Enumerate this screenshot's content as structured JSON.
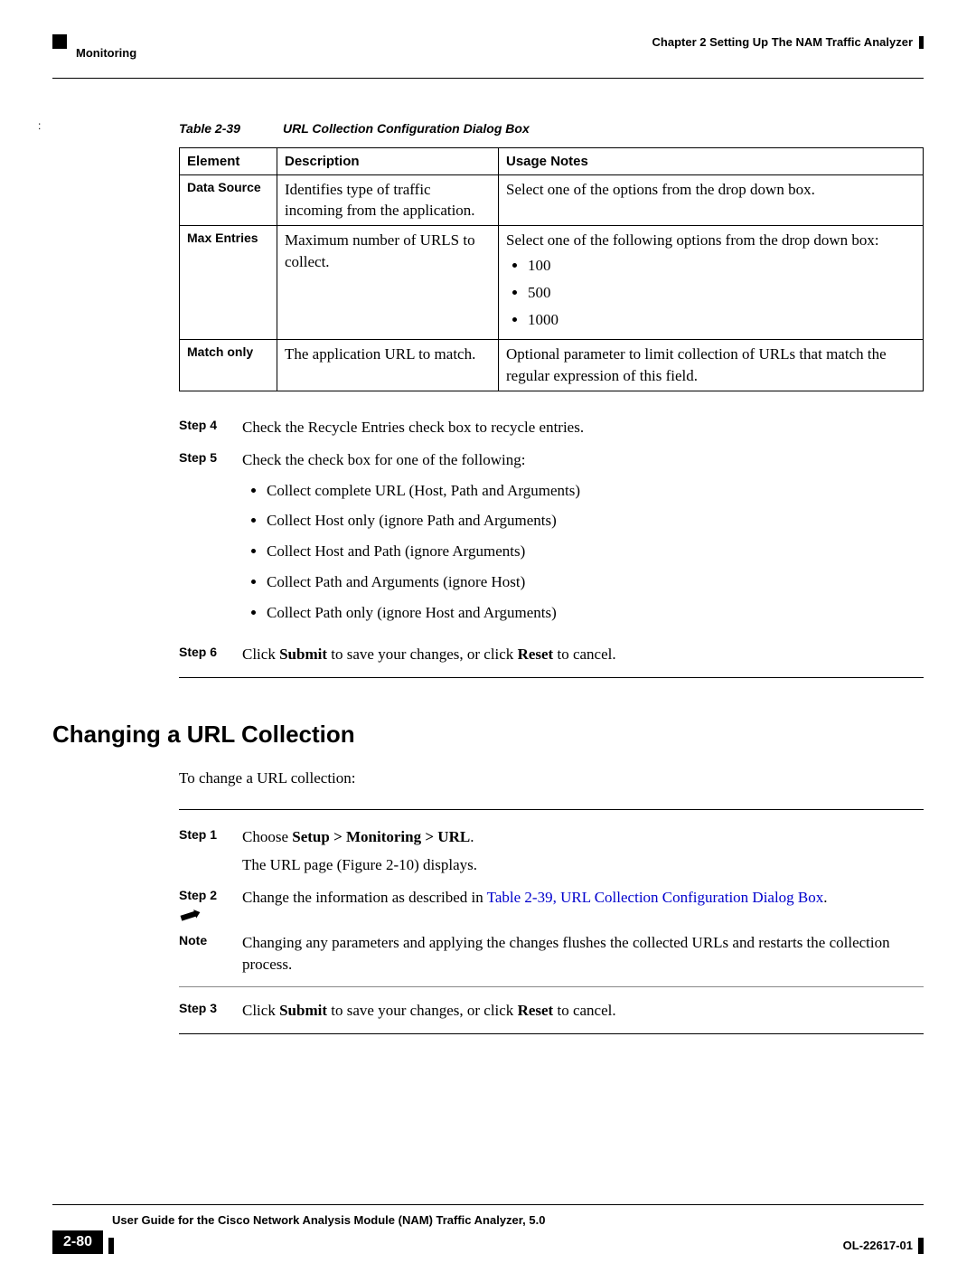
{
  "header": {
    "chapter_right": "Chapter 2      Setting Up The NAM Traffic Analyzer",
    "section_left": "Monitoring"
  },
  "table": {
    "caption_num": "Table 2-39",
    "caption_title": "URL Collection Configuration Dialog Box",
    "headers": {
      "c0": "Element",
      "c1": "Description",
      "c2": "Usage Notes"
    },
    "rows": {
      "r0": {
        "el": "Data Source",
        "desc": "Identifies type of traffic incoming from the application.",
        "usage": "Select one of the options from the drop down box."
      },
      "r1": {
        "el": "Max Entries",
        "desc": "Maximum number of URLS to collect.",
        "usage_intro": "Select one of the following options from the drop down box:",
        "opts": {
          "o0": "100",
          "o1": "500",
          "o2": "1000"
        }
      },
      "r2": {
        "el": "Match only",
        "desc": "The application URL to match.",
        "usage": "Optional parameter to limit collection of URLs that match the regular expression of this field."
      }
    }
  },
  "steps_a": {
    "s4": {
      "label": "Step 4",
      "text": "Check the Recycle Entries check box to recycle entries."
    },
    "s5": {
      "label": "Step 5",
      "text": "Check the check box for one of the following:",
      "items": {
        "i0": "Collect complete URL (Host, Path and Arguments)",
        "i1": "Collect Host only (ignore Path and Arguments)",
        "i2": "Collect Host and Path (ignore Arguments)",
        "i3": "Collect Path and Arguments (ignore Host)",
        "i4": "Collect Path only (ignore Host and Arguments)"
      }
    },
    "s6": {
      "label": "Step 6",
      "pre": "Click ",
      "b1": "Submit",
      "mid": " to save your changes, or click ",
      "b2": "Reset",
      "post": " to cancel."
    }
  },
  "heading": "Changing a URL Collection",
  "intro": "To change a URL collection:",
  "steps_b": {
    "s1": {
      "label": "Step 1",
      "pre": "Choose ",
      "b1": "Setup > Monitoring > URL",
      "post1": ".",
      "line2_pre": "The URL page (",
      "line2_link": "Figure 2-10",
      "line2_post": ") displays."
    },
    "s2": {
      "label": "Step 2",
      "pre": "Change the information as described in ",
      "link": "Table 2-39, URL Collection Configuration Dialog Box",
      "post": "."
    },
    "note": {
      "label": "Note",
      "text": "Changing any parameters and applying the changes flushes the collected URLs and restarts the collection process."
    },
    "s3": {
      "label": "Step 3",
      "pre": "Click ",
      "b1": "Submit",
      "mid": " to save your changes, or click ",
      "b2": "Reset",
      "post": " to cancel."
    }
  },
  "footer": {
    "book": "User Guide for the Cisco Network Analysis Module (NAM) Traffic Analyzer, 5.0",
    "page": "2-80",
    "doc": "OL-22617-01"
  }
}
